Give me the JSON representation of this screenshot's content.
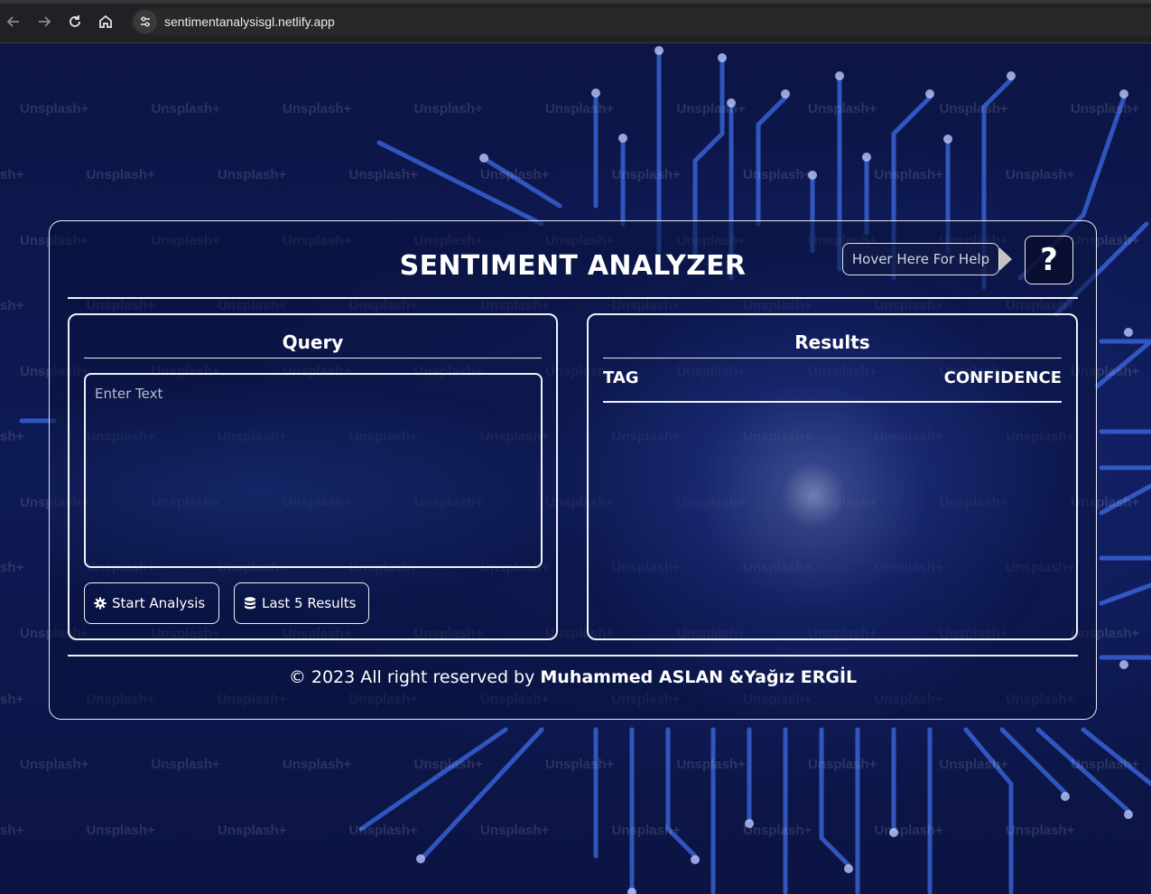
{
  "browser": {
    "url": "sentimentanalysisgl.netlify.app",
    "icons": [
      "back-arrow-icon",
      "forward-arrow-icon",
      "reload-icon",
      "home-icon",
      "site-info-icon"
    ]
  },
  "background": {
    "watermark_text": "Unsplash+"
  },
  "app": {
    "title": "SENTIMENT ANALYZER",
    "help_hint": "Hover Here For Help",
    "help_button": "?"
  },
  "query": {
    "title": "Query",
    "input_value": "",
    "input_placeholder": "Enter Text",
    "start_label": "Start Analysis",
    "start_icon": "gear-icon",
    "last_label": "Last 5 Results",
    "last_icon": "database-icon"
  },
  "results": {
    "title": "Results",
    "col_tag": "TAG",
    "col_confidence": "CONFIDENCE",
    "rows": []
  },
  "footer": {
    "prefix": "© 2023 All right reserved by ",
    "authors": "Muhammed ASLAN &Yağız ERGİL"
  },
  "colors": {
    "page_bg": "#0b1340",
    "card_border": "#e9ecf5",
    "accent_circuit": "#3f6fe0"
  }
}
